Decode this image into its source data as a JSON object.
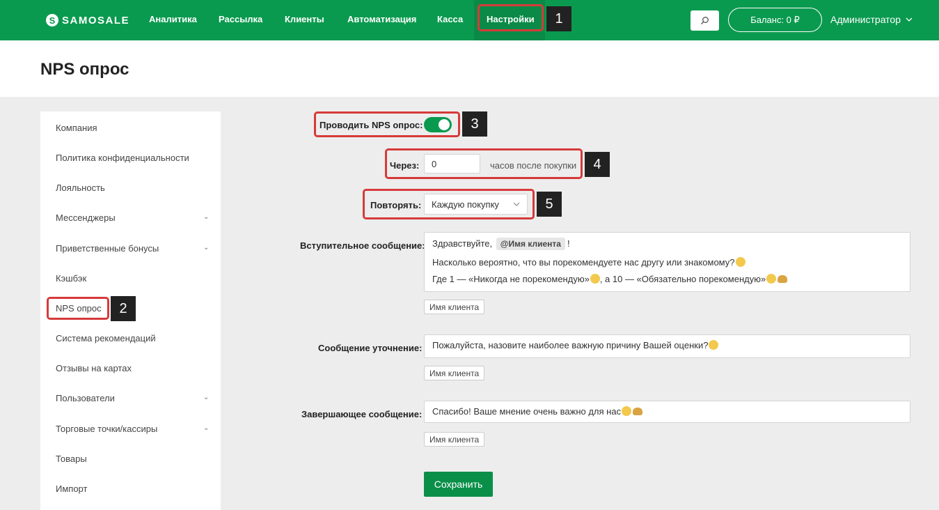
{
  "topbar": {
    "brand": "SAMOSALE",
    "brand_mark": "S",
    "nav": [
      "Аналитика",
      "Рассылка",
      "Клиенты",
      "Автоматизация",
      "Касса",
      "Настройки"
    ],
    "search_icon": "search-icon",
    "balance": "Баланс: 0 ₽",
    "user": "Администратор",
    "accent": "#0a9a4f"
  },
  "page": {
    "title": "NPS опрос"
  },
  "sidebar": {
    "items": [
      {
        "label": "Компания",
        "expandable": false
      },
      {
        "label": "Политика конфиденциальности",
        "expandable": false
      },
      {
        "label": "Лояльность",
        "expandable": false
      },
      {
        "label": "Мессенджеры",
        "expandable": true
      },
      {
        "label": "Приветственные бонусы",
        "expandable": true
      },
      {
        "label": "Кэшбэк",
        "expandable": false
      },
      {
        "label": "NPS опрос",
        "expandable": false
      },
      {
        "label": "Система рекомендаций",
        "expandable": false
      },
      {
        "label": "Отзывы на картах",
        "expandable": false
      },
      {
        "label": "Пользователи",
        "expandable": true
      },
      {
        "label": "Торговые точки/кассиры",
        "expandable": true
      },
      {
        "label": "Товары",
        "expandable": false
      },
      {
        "label": "Импорт",
        "expandable": false
      }
    ]
  },
  "form": {
    "nps_toggle_label": "Проводить NPS опрос:",
    "nps_enabled": true,
    "delay_label": "Через:",
    "delay_value": "0",
    "delay_hint": "часов после покупки",
    "repeat_label": "Повторять:",
    "repeat_value": "Каждую покупку",
    "intro_label": "Вступительное сообщение:",
    "intro_line1_prefix": "Здравствуйте,",
    "intro_tag": "@Имя клиента",
    "intro_line1_suffix": "!",
    "intro_line2": "Насколько вероятно, что вы порекомендуете нас другу или знакомому?",
    "intro_line3_a": "Где 1 — «Никогда не порекомендую»",
    "intro_line3_b": ", а 10 — «Обязательно порекомендую»",
    "clarify_label": "Сообщение уточнение:",
    "clarify_text": "Пожалуйста, назовите наиболее важную причину Вашей оценки?",
    "final_label": "Завершающее сообщение:",
    "final_text": "Спасибо! Ваше мнение очень важно для нас",
    "insert_chip": "Имя клиента",
    "save": "Сохранить"
  },
  "callouts": [
    "1",
    "2",
    "3",
    "4",
    "5"
  ],
  "highlight_color": "#d63a3a"
}
